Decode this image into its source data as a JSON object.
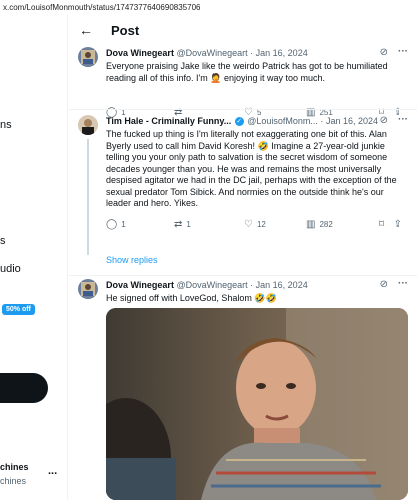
{
  "browser": {
    "url": "x.com/LouisofMonmouth/status/1747377640690835706"
  },
  "sidebar": {
    "fragments": [
      "ns",
      "s",
      "udio"
    ],
    "badge": "50% off",
    "account": {
      "name": "chines",
      "handle": "chines",
      "more": "..."
    }
  },
  "header": {
    "back_icon": "arrow-left-icon",
    "title": "Post"
  },
  "tweets": [
    {
      "name": "Dova Winegeart",
      "handle": "@DovaWinegeart",
      "sep": "·",
      "date": "Jan 16, 2024",
      "text": "Everyone praising Jake like the weirdo Patrick has got to be humiliated reading all of this info. I'm 🤦 enjoying it way too much.",
      "actions": {
        "reply": "1",
        "repost": "",
        "like": "5",
        "views": "251"
      }
    },
    {
      "name": "Tim Hale - Criminally Funny...",
      "handle": "@LouisofMonm...",
      "sep": "·",
      "date": "Jan 16, 2024",
      "text": "The fucked up thing is I'm literally not exaggerating one bit of this. Alan Byerly used to call him David Koresh! 🤣 Imagine a 27-year-old junkie telling you your only path to salvation is the secret wisdom of someone decades younger than you. He was and remains the most universally despised agitator we had in the DC jail, perhaps with the exception of the sexual predator Tom Sibick. And normies on the outside think he's our leader and hero. Yikes.",
      "actions": {
        "reply": "1",
        "repost": "1",
        "like": "12",
        "views": "282"
      },
      "show_replies": "Show replies"
    },
    {
      "name": "Dova Winegeart",
      "handle": "@DovaWinegeart",
      "sep": "·",
      "date": "Jan 16, 2024",
      "text": "He signed off with LoveGod, Shalom 🤣🤣"
    }
  ],
  "colors": {
    "accent": "#1d9bf0",
    "text": "#0f1419",
    "muted": "#536471",
    "border": "#eff3f4"
  }
}
